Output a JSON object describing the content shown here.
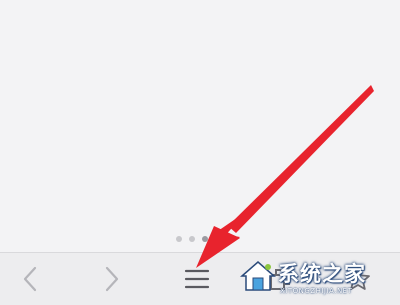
{
  "browser": {
    "page_indicator": {
      "count": 3,
      "active_index": 2
    },
    "toolbar": {
      "buttons": [
        {
          "id": "back",
          "icon": "chevron-left-icon"
        },
        {
          "id": "forward",
          "icon": "chevron-right-icon"
        },
        {
          "id": "menu",
          "icon": "hamburger-menu-icon"
        },
        {
          "id": "tabs",
          "icon": "tabs-icon"
        },
        {
          "id": "favorites",
          "icon": "star-icon"
        }
      ]
    }
  },
  "annotation": {
    "arrow_color": "#e8232d",
    "arrow_target": "menu"
  },
  "watermark": {
    "text": "系统之家",
    "subtext": "XITONGZHIJIA.NET"
  },
  "colors": {
    "background": "#f3f3f5",
    "toolbar_bg": "#ededef",
    "icon_color": "#8e8e93",
    "menu_icon_color": "#5a5a60"
  }
}
